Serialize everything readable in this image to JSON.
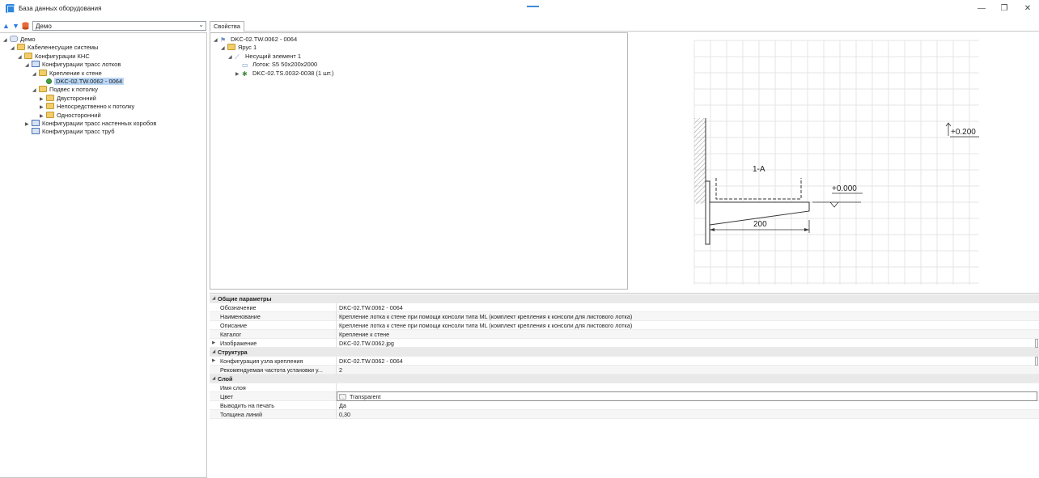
{
  "window": {
    "title": "База данных оборудования",
    "controls": [
      "—",
      "❐",
      "✕"
    ]
  },
  "left_panel": {
    "selector_value": "Демо",
    "tree": [
      {
        "label": "Демо",
        "icon": "database-icon",
        "level": 0,
        "expanded": true
      },
      {
        "label": "Кабеленесущие системы",
        "icon": "folder-icon",
        "level": 1,
        "expanded": true
      },
      {
        "label": "Конфигурации КНС",
        "icon": "folder-icon",
        "level": 2,
        "expanded": true
      },
      {
        "label": "Конфигурации трасс лотков",
        "icon": "table-icon",
        "level": 3,
        "expanded": true
      },
      {
        "label": "Крепление к стене",
        "icon": "folder-icon",
        "level": 4,
        "expanded": true
      },
      {
        "label": "DKC-02.TW.0062 - 0064",
        "icon": "item-icon",
        "level": 5,
        "selected": true
      },
      {
        "label": "Подвес к потолку",
        "icon": "folder-icon",
        "level": 4,
        "expanded": true
      },
      {
        "label": "Двусторонний",
        "icon": "folder-icon",
        "level": 5,
        "expanded": false
      },
      {
        "label": "Непосредственно к потолку",
        "icon": "folder-icon",
        "level": 5,
        "expanded": false
      },
      {
        "label": "Односторонний",
        "icon": "folder-icon",
        "level": 5,
        "expanded": false
      },
      {
        "label": "Конфигурации трасс настенных коробов",
        "icon": "table-icon",
        "level": 3,
        "expanded": false
      },
      {
        "label": "Конфигурации трасс труб",
        "icon": "table-icon",
        "level": 3
      }
    ]
  },
  "tabs": [
    {
      "label": "Свойства"
    }
  ],
  "structure_tree": [
    {
      "label": "DKC-02.TW.0062 - 0064",
      "icon": "flag-icon",
      "level": 0,
      "expanded": true
    },
    {
      "label": "Ярус 1",
      "icon": "folder-icon",
      "level": 1,
      "expanded": true
    },
    {
      "label": "Несущий элемент 1",
      "icon": "bracket-icon",
      "level": 2,
      "expanded": true
    },
    {
      "label": "Лоток: S5 50x200x2000",
      "icon": "tray-icon",
      "level": 3
    },
    {
      "label": "DKC-02.TS.0032-0038 (1 шт.)",
      "icon": "parts-icon",
      "level": 3,
      "expanded": false
    }
  ],
  "drawing": {
    "tray_label": "1-A",
    "elevation_top": "+0.200",
    "elevation_zero": "+0.000",
    "dimension": "200"
  },
  "properties": {
    "categories": [
      {
        "name": "Общие параметры",
        "rows": [
          {
            "key": "Обозначение",
            "value": "DKC-02.TW.0062 - 0064"
          },
          {
            "key": "Наименование",
            "value": "Крепление лотка к стене при помощи консоли типа ML (комплект крепления к консоли для листового лотка)"
          },
          {
            "key": "Описание",
            "value": "Крепление лотка к стене при помощи консоли типа ML (комплект крепления к консоли для листового лотка)"
          },
          {
            "key": "Каталог",
            "value": "Крепление к стене"
          },
          {
            "key": "Изображение",
            "value": "DKC-02.TW.0062.jpg",
            "expandable": true
          }
        ]
      },
      {
        "name": "Структура",
        "rows": [
          {
            "key": "Конфигурация узла крепления",
            "value": "DKC-02.TW.0062 - 0064",
            "expandable": true
          },
          {
            "key": "Рекомендуемая частота установки у...",
            "value": "2"
          }
        ]
      },
      {
        "name": "Слой",
        "rows": [
          {
            "key": "Имя слоя",
            "value": ""
          },
          {
            "key": "Цвет",
            "value": "Transparent"
          },
          {
            "key": "Выводить на печать",
            "value": "Да"
          },
          {
            "key": "Толщина линий",
            "value": "0,30"
          }
        ]
      }
    ]
  }
}
